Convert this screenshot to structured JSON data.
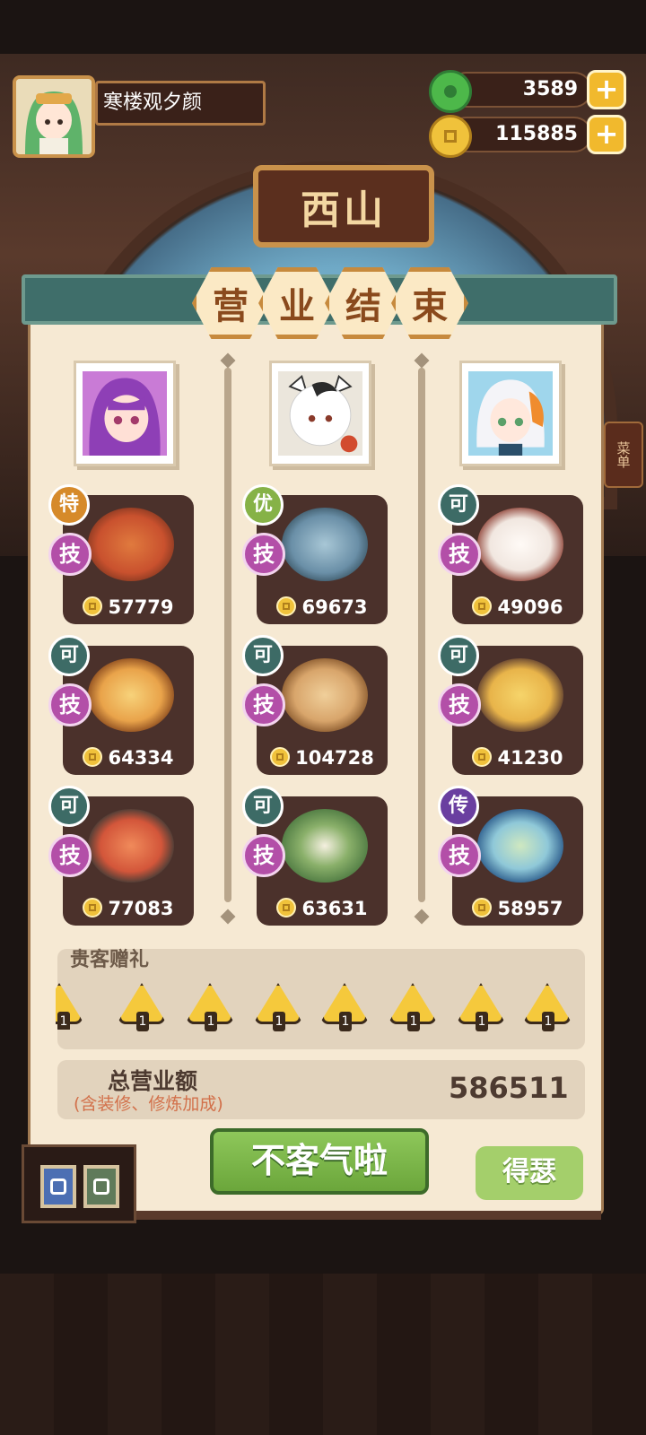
{
  "player": {
    "name": "寒楼观夕颜"
  },
  "resources": {
    "jade": "3589",
    "gold": "115885",
    "add_symbol": "+"
  },
  "scene": {
    "sign": "西山",
    "side_menu": "菜单"
  },
  "panel": {
    "title_chars": [
      "营",
      "业",
      "结",
      "束"
    ],
    "guests": [
      {
        "name": "guest-purple-hair",
        "colors": {
          "bg": "#b86ad1",
          "hair": "#8e3fb6",
          "skin": "#ffe0d6"
        }
      },
      {
        "name": "guest-white-tiger",
        "colors": {
          "bg": "#e9e4db",
          "hair": "#ffffff",
          "skin": "#ffe8dc"
        }
      },
      {
        "name": "guest-white-blue-hair",
        "colors": {
          "bg": "#8fd0ea",
          "hair": "#f2f2f6",
          "skin": "#ffe8dc"
        }
      }
    ],
    "dishes": [
      {
        "grade": "特",
        "skill": "技",
        "price": "57779",
        "grade_color": "#d68a2a",
        "plate": "#c9512e"
      },
      {
        "grade": "优",
        "skill": "技",
        "price": "69673",
        "grade_color": "#86b247",
        "plate": "#6a8fa7"
      },
      {
        "grade": "可",
        "skill": "技",
        "price": "49096",
        "grade_color": "#3d6b66",
        "plate": "#f1e7e0"
      },
      {
        "grade": "可",
        "skill": "技",
        "price": "64334",
        "grade_color": "#3d6b66",
        "plate": "#e9a34a"
      },
      {
        "grade": "可",
        "skill": "技",
        "price": "104728",
        "grade_color": "#3d6b66",
        "plate": "#d8a56b"
      },
      {
        "grade": "可",
        "skill": "技",
        "price": "41230",
        "grade_color": "#3d6b66",
        "plate": "#e8b44a"
      },
      {
        "grade": "可",
        "skill": "技",
        "price": "77083",
        "grade_color": "#3d6b66",
        "plate": "#d3563a"
      },
      {
        "grade": "可",
        "skill": "技",
        "price": "63631",
        "grade_color": "#3d6b66",
        "plate": "#4e7a42"
      },
      {
        "grade": "传",
        "skill": "技",
        "price": "58957",
        "grade_color": "#6a3fa0",
        "plate": "#8fc8d8"
      }
    ],
    "gifts_title": "贵客赠礼",
    "gifts": [
      {
        "count": "1"
      },
      {
        "count": "1"
      },
      {
        "count": "1"
      },
      {
        "count": "1"
      },
      {
        "count": "1"
      },
      {
        "count": "1"
      },
      {
        "count": "1"
      },
      {
        "count": "1"
      }
    ],
    "total_label": "总营业额",
    "total_note": "(含装修、修炼加成)",
    "total_value": "586511"
  },
  "buttons": {
    "confirm": "不客气啦",
    "side": "得瑟"
  }
}
